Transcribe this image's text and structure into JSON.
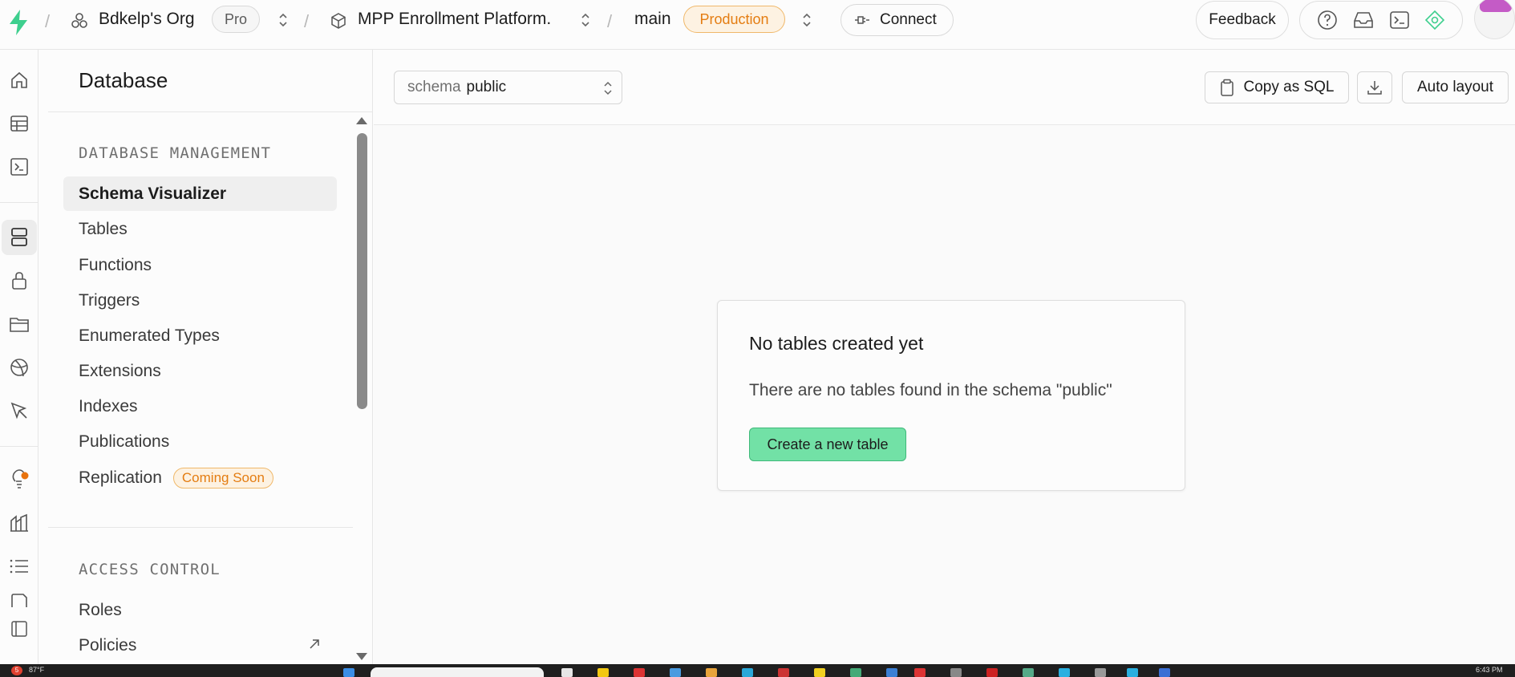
{
  "topbar": {
    "org_name": "Bdkelp's Org",
    "plan_badge": "Pro",
    "project_name": "MPP Enrollment Platform.",
    "branch_name": "main",
    "env_badge": "Production",
    "connect_label": "Connect",
    "feedback_label": "Feedback",
    "icons": [
      "help-icon",
      "inbox-icon",
      "terminal-icon",
      "advisor-icon"
    ]
  },
  "rail": {
    "items": [
      "home-icon",
      "table-editor-icon",
      "sql-editor-icon",
      "database-icon",
      "auth-icon",
      "storage-icon",
      "realtime-icon",
      "edge-functions-icon",
      "advisors-icon",
      "reports-icon",
      "logs-icon",
      "api-docs-icon",
      "integrations-icon"
    ]
  },
  "sidebar": {
    "title": "Database",
    "sections": [
      {
        "heading": "DATABASE MANAGEMENT",
        "items": [
          {
            "label": "Schema Visualizer",
            "active": true
          },
          {
            "label": "Tables"
          },
          {
            "label": "Functions"
          },
          {
            "label": "Triggers"
          },
          {
            "label": "Enumerated Types"
          },
          {
            "label": "Extensions"
          },
          {
            "label": "Indexes"
          },
          {
            "label": "Publications"
          },
          {
            "label": "Replication",
            "badge": "Coming Soon"
          }
        ]
      },
      {
        "heading": "ACCESS CONTROL",
        "items": [
          {
            "label": "Roles"
          },
          {
            "label": "Policies",
            "external": true
          }
        ]
      }
    ]
  },
  "toolbar": {
    "schema_label": "schema",
    "schema_value": "public",
    "copy_sql_label": "Copy as SQL",
    "auto_layout_label": "Auto layout"
  },
  "empty_state": {
    "title": "No tables created yet",
    "description": "There are no tables found in the schema \"public\"",
    "button_label": "Create a new table"
  },
  "taskbar": {
    "weather_badge": "5",
    "temperature": "87°F",
    "clock": "6:43 PM"
  },
  "colors": {
    "accent_green": "#3ECF8E",
    "create_button_bg": "#72E1A6",
    "production_orange": "#E47D12"
  }
}
